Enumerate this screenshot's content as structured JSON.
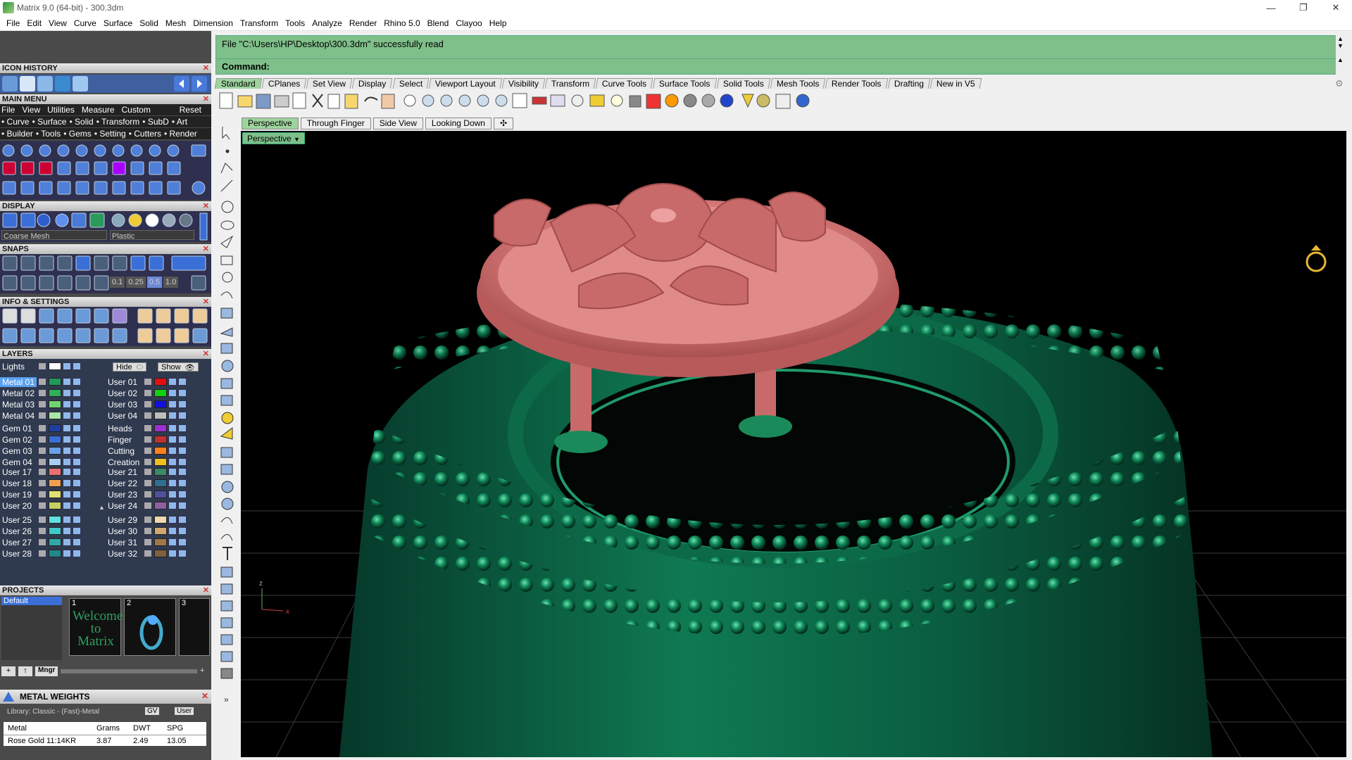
{
  "window": {
    "title": "Matrix 9.0 (64-bit) - 300.3dm",
    "buttons": [
      "—",
      "❐",
      "✕"
    ]
  },
  "menubar": [
    "File",
    "Edit",
    "View",
    "Curve",
    "Surface",
    "Solid",
    "Mesh",
    "Dimension",
    "Transform",
    "Tools",
    "Analyze",
    "Render",
    "Rhino 5.0",
    "Blend",
    "Clayoo",
    "Help"
  ],
  "panels": {
    "icon_history": "ICON HISTORY",
    "main_menu": "MAIN MENU",
    "main_menu_items": [
      "File",
      "View",
      "Utilities",
      "Measure",
      "Custom",
      "Reset"
    ],
    "categories_row1": [
      "Curve",
      "Surface",
      "Solid",
      "Transform",
      "SubD",
      "Art"
    ],
    "categories_row2": [
      "Builder",
      "Tools",
      "Gems",
      "Setting",
      "Cutters",
      "Render"
    ],
    "display": "DISPLAY",
    "display_mesh": "Coarse Mesh",
    "display_material": "Plastic",
    "snaps": "SNAPS",
    "snap_values": [
      "0.1",
      "0.25",
      "0.5",
      "1.0"
    ],
    "info_settings": "INFO & SETTINGS",
    "layers": "LAYERS",
    "projects": "PROJECTS",
    "metal_weights": "METAL WEIGHTS"
  },
  "layers": {
    "lights_label": "Lights",
    "hide_label": "Hide",
    "show_label": "Show",
    "left_group1": [
      {
        "name": "Metal 01",
        "color": "#1f9a5a",
        "selected": true
      },
      {
        "name": "Metal 02",
        "color": "#2fb05a"
      },
      {
        "name": "Metal 03",
        "color": "#6fd46f"
      },
      {
        "name": "Metal 04",
        "color": "#a9e6a9"
      }
    ],
    "right_group1": [
      {
        "name": "User 01",
        "color": "#e01010"
      },
      {
        "name": "User 02",
        "color": "#10d010"
      },
      {
        "name": "User 03",
        "color": "#1010e0"
      },
      {
        "name": "User 04",
        "color": "#bdbdbd"
      }
    ],
    "left_group2": [
      {
        "name": "Gem 01",
        "color": "#1f3fa0"
      },
      {
        "name": "Gem 02",
        "color": "#3a6fd8"
      },
      {
        "name": "Gem 03",
        "color": "#6aa0e8"
      },
      {
        "name": "Gem 04",
        "color": "#a8cdf2"
      }
    ],
    "right_group2": [
      {
        "name": "Heads",
        "color": "#9c2fd0"
      },
      {
        "name": "Finger",
        "color": "#c03030"
      },
      {
        "name": "Cutting",
        "color": "#ff7f20"
      },
      {
        "name": "Creation",
        "color": "#f0c020"
      }
    ],
    "left_group3": [
      {
        "name": "User 17",
        "color": "#e87070"
      },
      {
        "name": "User 18",
        "color": "#f0a050"
      },
      {
        "name": "User 19",
        "color": "#e0e070"
      },
      {
        "name": "User 20",
        "color": "#c8d060"
      }
    ],
    "right_group3": [
      {
        "name": "User 21",
        "color": "#3a8a6a"
      },
      {
        "name": "User 22",
        "color": "#2f6f8f"
      },
      {
        "name": "User 23",
        "color": "#4f4f9f"
      },
      {
        "name": "User 24",
        "color": "#8f5f9f"
      }
    ],
    "left_group4": [
      {
        "name": "User 25",
        "color": "#60e0e0"
      },
      {
        "name": "User 26",
        "color": "#40c8c8"
      },
      {
        "name": "User 27",
        "color": "#30a8a8"
      },
      {
        "name": "User 28",
        "color": "#208888"
      }
    ],
    "right_group4": [
      {
        "name": "User 29",
        "color": "#f0d8b0"
      },
      {
        "name": "User 30",
        "color": "#d0a870"
      },
      {
        "name": "User 31",
        "color": "#a07848"
      },
      {
        "name": "User 32",
        "color": "#806040"
      }
    ]
  },
  "projects": {
    "default": "Default",
    "thumbs": [
      "1",
      "2",
      "3"
    ],
    "welcome": "Welcome to Matrix",
    "mngr_button": "Mngr"
  },
  "metal_weights": {
    "library": "Library: Classic - (Fast)-Metal",
    "gv_label": "GV",
    "user_label": "User",
    "columns": [
      "Metal",
      "Grams",
      "DWT",
      "SPG"
    ],
    "rows": [
      [
        "Rose Gold 11:14KR",
        "3.87",
        "2.49",
        "13.05"
      ]
    ]
  },
  "command": {
    "status": "File \"C:\\Users\\HP\\Desktop\\300.3dm\" successfully read",
    "prompt": "Command:"
  },
  "toolbar_tabs": [
    "Standard",
    "CPlanes",
    "Set View",
    "Display",
    "Select",
    "Viewport Layout",
    "Visibility",
    "Transform",
    "Curve Tools",
    "Surface Tools",
    "Solid Tools",
    "Mesh Tools",
    "Render Tools",
    "Drafting",
    "New in V5"
  ],
  "viewport_tabs": [
    "Perspective",
    "Through Finger",
    "Side View",
    "Looking Down"
  ],
  "viewport_label": "Perspective",
  "axis_labels": {
    "z": "z",
    "x": "x"
  },
  "colors": {
    "command_bg": "#7fbf8a",
    "active_tab": "#9ed39e",
    "model_green": "#0f6a48",
    "model_pink": "#d97a7a"
  }
}
